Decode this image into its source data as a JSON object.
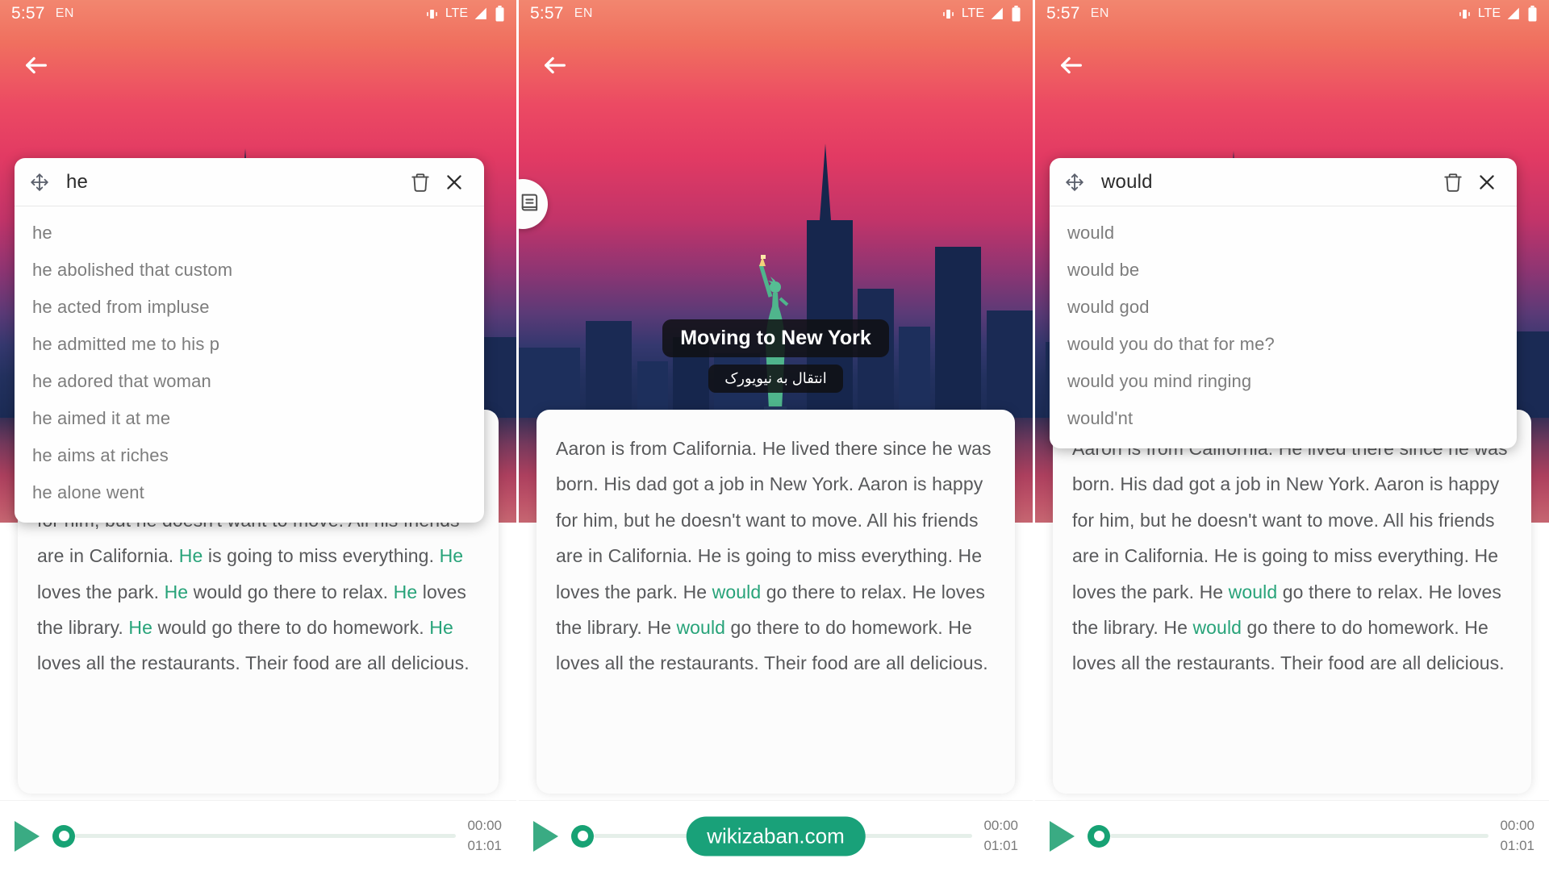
{
  "status_bar": {
    "time": "5:57",
    "language": "EN",
    "network": "LTE",
    "icons": [
      "vibrate-icon",
      "signal-icon",
      "battery-icon"
    ]
  },
  "nav": {
    "back_label": "back-arrow"
  },
  "lesson": {
    "title": "Moving to New York",
    "subtitle_fa": "انتقال به نیویورک",
    "body_segments": [
      {
        "text": "Aaron is from California. He lived there since he was born. His dad got a job in New York. Aaron is happy for him, but he doesn't want to move. All his friends are in California. ",
        "highlight": false
      },
      {
        "text": "He",
        "highlight": true
      },
      {
        "text": " is going to miss everything. ",
        "highlight": false
      },
      {
        "text": "He",
        "highlight": true
      },
      {
        "text": " loves the park. ",
        "highlight": false
      },
      {
        "text": "He",
        "highlight": true
      },
      {
        "text": " would go there to relax. ",
        "highlight": false
      },
      {
        "text": "He",
        "highlight": true
      },
      {
        "text": " loves the library. ",
        "highlight": false
      },
      {
        "text": "He",
        "highlight": true
      },
      {
        "text": " would go there to do homework. ",
        "highlight": false
      },
      {
        "text": "He",
        "highlight": true
      },
      {
        "text": " loves all the restaurants. Their food are all delicious.",
        "highlight": false
      }
    ],
    "body_segments_would": [
      {
        "text": "Aaron is from California. He lived there since he was born. His dad got a job in New York. Aaron is happy for him, but he doesn't want to move. All his friends are in California. He is going to miss everything. He loves the park. He ",
        "highlight": false
      },
      {
        "text": "would",
        "highlight": true
      },
      {
        "text": " go there to relax. He loves the library. He ",
        "highlight": false
      },
      {
        "text": "would",
        "highlight": true
      },
      {
        "text": " go there to do homework. He loves all the restaurants. Their food are all delicious.",
        "highlight": false
      }
    ]
  },
  "player": {
    "play_label": "play-icon",
    "current_time": "00:00",
    "total_time": "01:01",
    "progress_percent": 0
  },
  "watermark": {
    "text": "wikizaban.com"
  },
  "colors": {
    "accent_green": "#19a179",
    "highlight_green": "#27a379",
    "track_bg": "#e5efe9",
    "popup_bg": "#fefefe",
    "text_body": "#58595b",
    "text_suggestion": "#7d7d7d"
  },
  "panels": [
    {
      "id": "panel-he",
      "search": {
        "value": "he",
        "move_icon": "move-icon",
        "delete_icon": "trash-icon",
        "close_icon": "close-icon"
      },
      "suggestions": [
        "he",
        "he abolished that custom",
        "he acted from impluse",
        "he admitted me to his p",
        "he adored that woman",
        "he aimed it at me",
        "he aims at riches",
        "he alone went"
      ],
      "has_fab": false,
      "has_title": false,
      "has_watermark": false
    },
    {
      "id": "panel-article",
      "search": null,
      "suggestions": [],
      "has_fab": true,
      "fab_icon": "book-icon",
      "has_title": true,
      "has_watermark": true
    },
    {
      "id": "panel-would",
      "search": {
        "value": "would",
        "move_icon": "move-icon",
        "delete_icon": "trash-icon",
        "close_icon": "close-icon"
      },
      "suggestions": [
        "would",
        "would be",
        "would god",
        "would you do that for me?",
        "would you mind ringing",
        "would'nt"
      ],
      "has_fab": false,
      "has_title": false,
      "has_watermark": false
    }
  ]
}
